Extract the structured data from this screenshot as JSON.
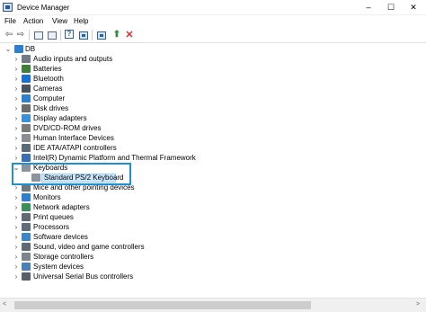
{
  "window": {
    "title": "Device Manager",
    "minimize": "–",
    "maximize": "☐",
    "close": "✕"
  },
  "menu": [
    "File",
    "Action",
    "View",
    "Help"
  ],
  "toolbar": [
    "back-arrow-icon",
    "forward-arrow-icon",
    "properties-grid-icon",
    "help-question-icon",
    "update-driver-icon",
    "scan-monitor-icon",
    "enable-device-icon",
    "uninstall-x-icon"
  ],
  "tree": {
    "root": "DB",
    "items": [
      {
        "label": "Audio inputs and outputs",
        "icon": "speaker-icon",
        "color": "#6f7b86"
      },
      {
        "label": "Batteries",
        "icon": "battery-icon",
        "color": "#3e7d3a"
      },
      {
        "label": "Bluetooth",
        "icon": "bluetooth-icon",
        "color": "#1a6fd1"
      },
      {
        "label": "Cameras",
        "icon": "camera-icon",
        "color": "#47525e"
      },
      {
        "label": "Computer",
        "icon": "computer-icon",
        "color": "#2f7fcf"
      },
      {
        "label": "Disk drives",
        "icon": "disk-drive-icon",
        "color": "#6b6b6b"
      },
      {
        "label": "Display adapters",
        "icon": "display-adapter-icon",
        "color": "#3a8fd8"
      },
      {
        "label": "DVD/CD-ROM drives",
        "icon": "dvd-drive-icon",
        "color": "#7a7a7a"
      },
      {
        "label": "Human Interface Devices",
        "icon": "hid-icon",
        "color": "#8a8f94"
      },
      {
        "label": "IDE ATA/ATAPI controllers",
        "icon": "ide-controller-icon",
        "color": "#5a6b7a"
      },
      {
        "label": "Intel(R) Dynamic Platform and Thermal Framework",
        "icon": "thermal-icon",
        "color": "#3b6fb0"
      },
      {
        "label": "Keyboards",
        "icon": "keyboard-icon",
        "color": "#8a949c",
        "expanded": true,
        "children": [
          {
            "label": "Standard PS/2 Keyboard",
            "icon": "keyboard-icon",
            "color": "#8a949c",
            "selected": true
          }
        ]
      },
      {
        "label": "Mice and other pointing devices",
        "icon": "mouse-icon",
        "color": "#6c7680"
      },
      {
        "label": "Monitors",
        "icon": "monitor-icon",
        "color": "#2f7fcf"
      },
      {
        "label": "Network adapters",
        "icon": "network-adapter-icon",
        "color": "#3a8f5a"
      },
      {
        "label": "Print queues",
        "icon": "printer-icon",
        "color": "#616b75"
      },
      {
        "label": "Processors",
        "icon": "processor-icon",
        "color": "#5d6d7d"
      },
      {
        "label": "Software devices",
        "icon": "software-device-icon",
        "color": "#3d87c9"
      },
      {
        "label": "Sound, video and game controllers",
        "icon": "sound-controller-icon",
        "color": "#5e6a76"
      },
      {
        "label": "Storage controllers",
        "icon": "storage-controller-icon",
        "color": "#7d858c"
      },
      {
        "label": "System devices",
        "icon": "system-device-icon",
        "color": "#4a7fb8"
      },
      {
        "label": "Universal Serial Bus controllers",
        "icon": "usb-controller-icon",
        "color": "#55606b"
      }
    ]
  },
  "scroll": {
    "left": "<",
    "right": ">"
  }
}
